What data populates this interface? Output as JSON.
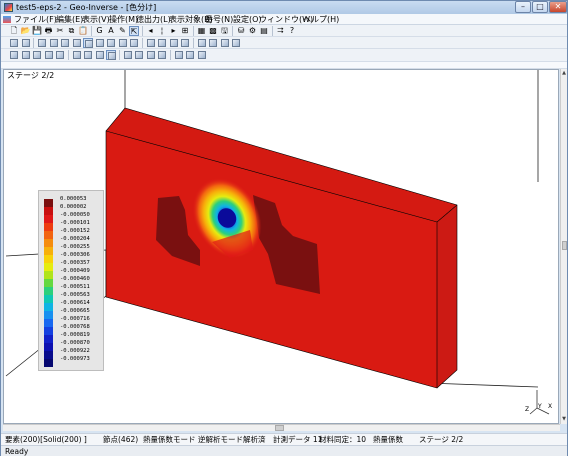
{
  "window": {
    "title": "test5-eps-2 - Geo-Inverse - [色分け]",
    "min_glyph": "–",
    "max_glyph": "□",
    "close_glyph": "✕"
  },
  "menu": [
    "ファイル(F)",
    "編集(E)",
    "表示(V)",
    "操作(M)",
    "徳出力(L)",
    "表示対象(B)",
    "番号(N)",
    "設定(O)",
    "ウィンドウ(W)",
    "ヘルプ(H)"
  ],
  "toolbars": {
    "row1": [
      "new-icon",
      "open-icon",
      "save-icon",
      "print-icon",
      "cut-icon",
      "copy-icon",
      "paste-icon",
      "g-icon",
      "text-a-icon",
      "pen-icon",
      "cursor-icon",
      "prev-icon",
      "vscale-icon",
      "next-icon",
      "calc-icon",
      "grid-icon",
      "color-map-icon",
      "save-red-icon",
      "db-icon",
      "gear-icon",
      "table-icon",
      "arrows-icon",
      "help-cursor-icon"
    ],
    "row1_glyphs": [
      "🗋",
      "📂",
      "💾",
      "🖶",
      "✂",
      "⧉",
      "📋",
      "G",
      "A",
      "✎",
      "⇱",
      "◂",
      "¦",
      "▸",
      "⊞",
      "▦",
      "▩",
      "🖫",
      "⛁",
      "⚙",
      "▤",
      "⮆",
      "?"
    ],
    "row2": [
      "axis-icon",
      "fill-icon",
      "box-icon",
      "green-icon",
      "yellow-icon",
      "layers-icon",
      "grid2-icon",
      "mesh-icon",
      "v-icon",
      "bars-icon",
      "bars2-icon",
      "iso-icon",
      "hist-icon",
      "plot-icon",
      "wave-icon",
      "tilt-icon",
      "bars3-icon",
      "cube-icon",
      "blue-icon"
    ],
    "row3": [
      "rotate-left-icon",
      "rotate-right-icon",
      "turn-left-icon",
      "turn-right-icon",
      "move-icon",
      "zoom-in-icon",
      "zoom-out-icon",
      "view-front-icon",
      "view-select-icon",
      "grid-off-icon",
      "box-off-icon",
      "red-box-icon",
      "frame-icon",
      "pen-off-icon",
      "eraser-icon",
      "fill-off-icon"
    ]
  },
  "view": {
    "stage_label": "ステージ 2/2",
    "axis_labels": {
      "z": "Z",
      "y": "Y",
      "x": "X"
    }
  },
  "legend": {
    "values": [
      "0.000053",
      "0.000002",
      "-0.000050",
      "-0.000101",
      "-0.000152",
      "-0.000204",
      "-0.000255",
      "-0.000306",
      "-0.000357",
      "-0.000409",
      "-0.000460",
      "-0.000511",
      "-0.000563",
      "-0.000614",
      "-0.000665",
      "-0.000716",
      "-0.000768",
      "-0.000819",
      "-0.000870",
      "-0.000922",
      "-0.000973"
    ],
    "colors": [
      "#7a1010",
      "#c81010",
      "#e01818",
      "#ee3c10",
      "#f26410",
      "#f58c0c",
      "#f7b00a",
      "#f8d20a",
      "#e6ec10",
      "#b0e41c",
      "#64d840",
      "#2cd07c",
      "#10c8b4",
      "#10b4e4",
      "#1890f0",
      "#1868f0",
      "#1440e0",
      "#1020c8",
      "#0c10b0",
      "#080c8c",
      "#060870"
    ]
  },
  "info": [
    "要素(200)[Solid(200) ]",
    "節点(462)",
    "熱量係数モード",
    "逆解析モード",
    "解析済",
    "計測データ 11",
    "材料同定：10",
    "熱量係数",
    "ステージ 2/2"
  ],
  "status": "Ready"
}
